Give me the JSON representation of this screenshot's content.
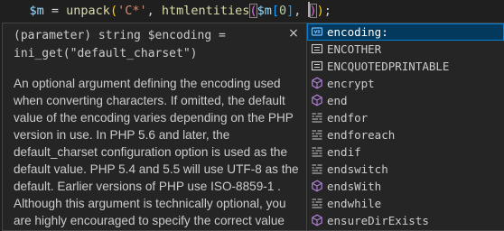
{
  "code": {
    "tokens": [
      {
        "text": "    ",
        "cls": "c-op"
      },
      {
        "text": "$m",
        "cls": "c-var"
      },
      {
        "text": " = ",
        "cls": "c-op"
      },
      {
        "text": "unpack",
        "cls": "c-fn"
      },
      {
        "text": "(",
        "cls": "c-brk"
      },
      {
        "text": "'C*'",
        "cls": "c-str"
      },
      {
        "text": ", ",
        "cls": "c-op"
      },
      {
        "text": "htmlentities",
        "cls": "c-fn"
      },
      {
        "text": "(",
        "cls": "c-paren1 paren-match"
      },
      {
        "text": "$m",
        "cls": "c-var"
      },
      {
        "text": "[",
        "cls": "c-paren2"
      },
      {
        "text": "0",
        "cls": "c-num"
      },
      {
        "text": "]",
        "cls": "c-paren2"
      },
      {
        "text": ", ",
        "cls": "c-op"
      },
      {
        "text": "CURSOR",
        "cls": "cursor"
      },
      {
        "text": ")",
        "cls": "c-paren1 paren-match"
      },
      {
        "text": ")",
        "cls": "c-brk"
      },
      {
        "text": ";",
        "cls": "c-op"
      }
    ]
  },
  "details": {
    "signature": "(parameter) string $encoding = ini_get(\"default_charset\")",
    "close_glyph": "×",
    "documentation": "An optional argument defining the encoding used when converting characters.  If omitted, the default value of the encoding varies depending on the PHP version in use. In PHP 5.6 and later, the default_charset configuration option is used as the default value. PHP 5.4 and 5.5 will use UTF-8 as the default. Earlier versions of PHP use ISO-8859-1 . Although this argument is technically optional, you are highly encouraged to specify the correct value"
  },
  "suggest": {
    "items": [
      {
        "label": "encoding:",
        "icon": "variable-icon",
        "selected": true
      },
      {
        "label": "ENCOTHER",
        "icon": "constant-icon",
        "selected": false
      },
      {
        "label": "ENCQUOTEDPRINTABLE",
        "icon": "constant-icon",
        "selected": false
      },
      {
        "label": "encrypt",
        "icon": "method-icon",
        "selected": false
      },
      {
        "label": "end",
        "icon": "method-icon",
        "selected": false
      },
      {
        "label": "endfor",
        "icon": "keyword-icon",
        "selected": false
      },
      {
        "label": "endforeach",
        "icon": "keyword-icon",
        "selected": false
      },
      {
        "label": "endif",
        "icon": "keyword-icon",
        "selected": false
      },
      {
        "label": "endswitch",
        "icon": "keyword-icon",
        "selected": false
      },
      {
        "label": "endsWith",
        "icon": "method-icon",
        "selected": false
      },
      {
        "label": "endwhile",
        "icon": "keyword-icon",
        "selected": false
      },
      {
        "label": "ensureDirExists",
        "icon": "method-icon",
        "selected": false
      }
    ]
  },
  "colors": {
    "background": "#1f1f1f",
    "widget_background": "#252526",
    "selection": "#04395e",
    "focus_border": "#007fd4",
    "method_icon": "#b180d7",
    "variable_icon": "#75beff"
  }
}
